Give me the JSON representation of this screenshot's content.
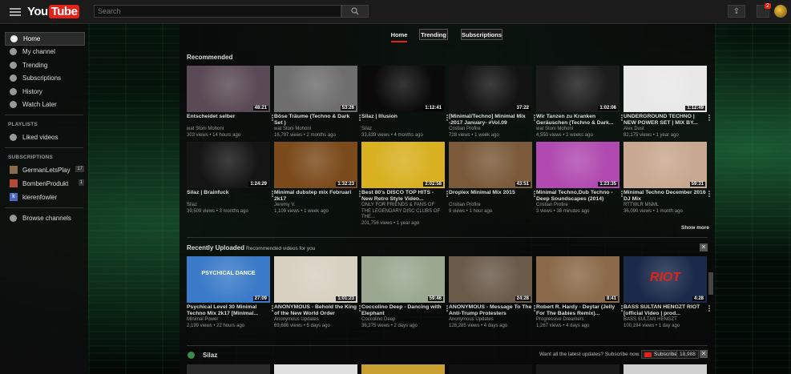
{
  "logo": {
    "you": "You",
    "tube": "Tube"
  },
  "search": {
    "placeholder": "Search"
  },
  "notifications": {
    "count": "2"
  },
  "sidebar": {
    "nav": [
      {
        "label": "Home",
        "icon": "home-icon"
      },
      {
        "label": "My channel",
        "icon": "person-icon"
      },
      {
        "label": "Trending",
        "icon": "flame-icon"
      },
      {
        "label": "Subscriptions",
        "icon": "subscriptions-icon"
      },
      {
        "label": "History",
        "icon": "history-icon"
      },
      {
        "label": "Watch Later",
        "icon": "clock-icon"
      }
    ],
    "playlists_heading": "PLAYLISTS",
    "playlists": [
      {
        "label": "Liked videos",
        "icon": "thumb-up-icon"
      }
    ],
    "subscriptions_heading": "SUBSCRIPTIONS",
    "subscriptions": [
      {
        "label": "GermanLetsPlay",
        "count": "17",
        "color": "#8a6a4a"
      },
      {
        "label": "BombenProdukt",
        "count": "1",
        "color": "#b04a3a"
      },
      {
        "label": "kierenfowler",
        "count": "",
        "color": "#4a6ac0"
      }
    ],
    "browse": "Browse channels"
  },
  "tabs": [
    {
      "label": "Home"
    },
    {
      "label": "Trending"
    },
    {
      "label": "Subscriptions"
    }
  ],
  "recommended": {
    "title": "Recommended",
    "show_more": "Show more",
    "videos": [
      {
        "title": "Entscheidet selber",
        "channel": "wat Stoni Mohoni",
        "stats": "303 views • 14 hours ago",
        "duration": "48:21",
        "bg": "#5a4a55"
      },
      {
        "title": "Böse Träume (Techno & Dark Set )",
        "channel": "wat Stoni Mohoni",
        "stats": "16,797 views • 2 months ago",
        "duration": "53:26",
        "bg": "#6e6e6e"
      },
      {
        "title": "Silaz | Illusion",
        "channel": "Silaz",
        "stats": "33,839 views • 4 months ago",
        "duration": "1:12:41",
        "bg": "#0a0a0a"
      },
      {
        "title": "[Minimal/Techno] Minimal Mix -2017 January- #Vol.09",
        "channel": "Cristian Profire",
        "stats": "728 views • 1 week ago",
        "duration": "37:22",
        "bg": "#121212"
      },
      {
        "title": "Wir Tanzen zu Kranken Geräuschen (Techno & Dark...",
        "channel": "wat Stoni Mohoni",
        "stats": "4,550 views • 2 weeks ago",
        "duration": "1:02:06",
        "bg": "#1c1c1c"
      },
      {
        "title": "UNDERGROUND TECHNO | NEW POWER SET | MIX BY...",
        "channel": "Alex Dust",
        "stats": "82,175 views • 1 year ago",
        "duration": "1:12:49",
        "bg": "#e8e8e8"
      },
      {
        "title": "Silaz | Brainfuck",
        "channel": "Silaz",
        "stats": "39,509 views • 3 months ago",
        "duration": "1:24:29",
        "bg": "#151515"
      },
      {
        "title": "Minimal dubstep mix Februari 2k17",
        "channel": "Jeremy V.",
        "stats": "1,109 views • 1 week ago",
        "duration": "1:32:23",
        "bg": "#7a4a1a"
      },
      {
        "title": "Best 80's DISCO TOP HITS - New Retro Style Video...",
        "channel": "ONLY FOR FRIENDS & FANS OF THE LEGENDARY DISC CLUBS OF THE...",
        "stats": "201,756 views • 1 year ago",
        "duration": "2:02:58",
        "bg": "#d8b020"
      },
      {
        "title": "Droplex Minimal Mix 2015",
        "channel": "Cristian Profire",
        "stats": "9 views • 1 hour ago",
        "duration": "43:51",
        "bg": "#7a5a3a"
      },
      {
        "title": "Minimal Techno,Dub Techno - Deep Soundscapes (2014)",
        "channel": "Cristian Profire",
        "stats": "3 views • 38 minutes ago",
        "duration": "1:23:35",
        "bg": "#b04ab0"
      },
      {
        "title": "Minimal Techno December 2016 DJ Mix",
        "channel": "RTTWLR MNML",
        "stats": "36,090 views • 1 month ago",
        "duration": "59:31",
        "bg": "#c8a890"
      }
    ]
  },
  "recent": {
    "title": "Recently Uploaded",
    "subtitle": "Recommended videos for you",
    "videos": [
      {
        "title": "Psychical Level 30 Minimal Techno Mix 2k17 [Minimal...",
        "channel": "Minimal Power",
        "stats": "2,199 views • 22 hours ago",
        "duration": "27:09",
        "bg": "#3a7ac8",
        "thumb_text": "PSYCHICAL DANCE"
      },
      {
        "title": "ANONYMOUS - Behold the King of the New World Order",
        "channel": "Anonymous Updates",
        "stats": "69,686 views • 5 days ago",
        "duration": "1:01:23",
        "bg": "#d8d0c0",
        "thumb_text": ""
      },
      {
        "title": "Coccolino Deep - Dancing with Elephant",
        "channel": "Coccolino Deep",
        "stats": "36,275 views • 2 days ago",
        "duration": "59:46",
        "bg": "#9aa890",
        "thumb_text": ""
      },
      {
        "title": "ANONYMOUS - Message To The Anti-Trump Protesters",
        "channel": "Anonymous Updates",
        "stats": "128,285 views • 4 days ago",
        "duration": "24:28",
        "bg": "#6a5a4a",
        "thumb_text": ""
      },
      {
        "title": "Robert R. Hardy - Deytar (Jelly For The Babies Remix)...",
        "channel": "Progressive Dreamers",
        "stats": "1,267 views • 4 days ago",
        "duration": "8:41",
        "bg": "#8a6a4a",
        "thumb_text": ""
      },
      {
        "title": "BASS SULTAN HENGZT RIOT [official Video | prod...",
        "channel": "BASS SULTAN HENGZT",
        "stats": "100,194 views • 1 day ago",
        "duration": "4:28",
        "bg": "#1a2a4a",
        "thumb_text": "RIOT"
      }
    ]
  },
  "channel_shelf": {
    "name": "Silaz",
    "prompt": "Want all the latest updates? Subscribe now.",
    "subscribe_label": "Subscribe",
    "subscriber_count": "18,988"
  },
  "colors": {
    "accent": "#e62117"
  }
}
